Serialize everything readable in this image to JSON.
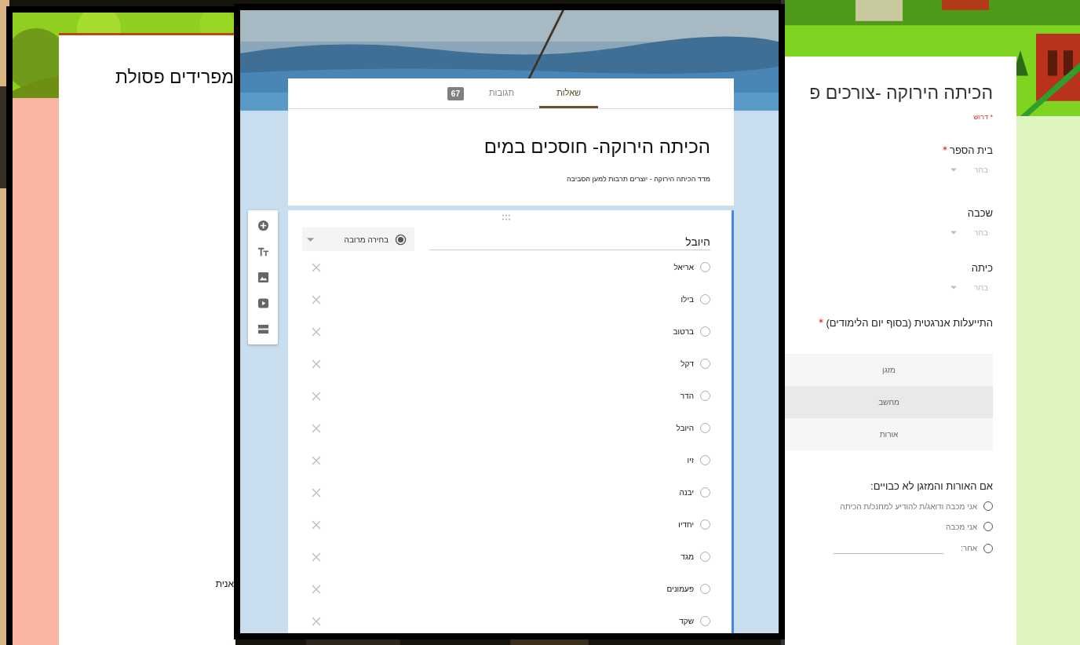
{
  "left_window": {
    "title": "מפרידים פסולת",
    "footer_text": "אנית"
  },
  "editor_window": {
    "tabs": [
      {
        "label": "שאלות",
        "selected": true
      },
      {
        "label": "תגובות",
        "selected": false,
        "badge": "67"
      }
    ],
    "title": "הכיתה הירוקה- חוסכים במים",
    "description": "מדד הכיתה הירוקה - יוצרים תרבות למען הסביבה",
    "question": {
      "title": "היובל",
      "type_label": "בחירה מרובה",
      "options": [
        {
          "label": "אריאל",
          "checked": false
        },
        {
          "label": "בילו",
          "checked": false
        },
        {
          "label": "ברטוב",
          "checked": false
        },
        {
          "label": "דקל",
          "checked": false
        },
        {
          "label": "הדר",
          "checked": false
        },
        {
          "label": "היובל",
          "checked": false
        },
        {
          "label": "זיו",
          "checked": false
        },
        {
          "label": "יבנה",
          "checked": false
        },
        {
          "label": "יחדיו",
          "checked": false
        },
        {
          "label": "מגד",
          "checked": false
        },
        {
          "label": "פעמונים",
          "checked": false
        },
        {
          "label": "שקד",
          "checked": false
        }
      ]
    }
  },
  "form_window": {
    "title": "הכיתה הירוקה -צורכים פ",
    "required_note": "* דרוש",
    "questions": [
      {
        "kind": "dropdown",
        "title": "בית הספר",
        "required": true,
        "prompt": "בחר"
      },
      {
        "kind": "dropdown",
        "title": "שכבה",
        "required": false,
        "prompt": "בחר"
      },
      {
        "kind": "dropdown",
        "title": "כיתה",
        "required": false,
        "prompt": "בחר"
      },
      {
        "kind": "grid",
        "title": "התייעלות אנרגטית (בסוף יום הלימודים)",
        "required": true,
        "rows": [
          {
            "label": "מזגן",
            "highlighted": false
          },
          {
            "label": "מחשב",
            "highlighted": true
          },
          {
            "label": "אורות",
            "highlighted": false
          }
        ]
      },
      {
        "kind": "radio",
        "title": "אם האורות והמזגן לא כבויים:",
        "required": false,
        "options": [
          {
            "label": "אני מכבה ודואג/ת להודיע למחנכ/ת הכיתה",
            "kind": "plain",
            "checked": false
          },
          {
            "label": "אני מכבה",
            "kind": "plain",
            "checked": false
          },
          {
            "label": "אחר:",
            "kind": "other",
            "checked": false
          }
        ]
      }
    ]
  }
}
